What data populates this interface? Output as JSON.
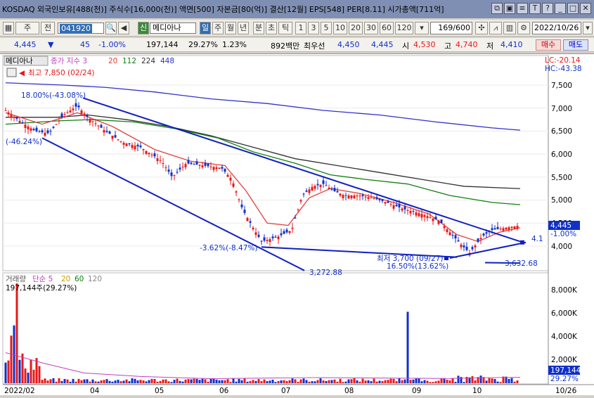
{
  "title_text": "KOSDAQ 외국인보유[488(천)] 주식수[16,000(천)] 액면[500] 자본금[80(억)] 결산[12월] EPS[548] PER[8.11] 시가총액[711억]",
  "toolbar": {
    "type_select": "주",
    "prev_label": "전",
    "code": "041920",
    "credit_badge": "신",
    "stock_name": "메디아나",
    "period_tabs": [
      "일",
      "주",
      "월",
      "년",
      "분",
      "초",
      "틱"
    ],
    "minute_options": [
      "1",
      "3",
      "5",
      "10",
      "20",
      "30",
      "60",
      "120"
    ],
    "page_counter": "169/600",
    "date": "2022/10/26"
  },
  "quote": {
    "price": "4,445",
    "change": "45",
    "change_pct": "-1.00%",
    "volume": "197,144",
    "turnover_pct": "29.27%",
    "rate": "1.23%",
    "amount": "892백만",
    "priority": "최우선",
    "bid": "4,450",
    "ask": "4,445",
    "open_label": "시",
    "open": "4,530",
    "high_label": "고",
    "high": "4,740",
    "low_label": "저",
    "low": "4,410",
    "buy_label": "매수",
    "sell_label": "매도"
  },
  "price_legend": {
    "stock": "메디아나",
    "ma_label": "종가 지수 3",
    "ma": [
      "20",
      "112",
      "224",
      "448"
    ],
    "lc": "LC:-20.14",
    "hc": "HC:-43.38",
    "high_note": "최고 7,850 (02/24)",
    "ann_top": "18.00%(-43.08%)",
    "ann_left": "(-46.24%)",
    "ann_low": "-3.62%(-8.47%)",
    "ann_min": "최저 3,700 (09/27)",
    "ann_min2": "16.50%(13.62%)",
    "ann_line": "3,632.68",
    "ann_bottom": "3,272.88",
    "ann_right": "4.1",
    "cur_price_tag": "4,445",
    "cur_pct_tag": "-1.00%",
    "price_ticks": [
      "7,500",
      "7,000",
      "6,500",
      "6,000",
      "5,500",
      "5,000",
      "4,500",
      "4,000"
    ]
  },
  "volume_legend": {
    "label": "거래량",
    "ma_label": "단순 5",
    "ma": [
      "20",
      "60",
      "120"
    ],
    "vol_note": "197,144주(29.27%)",
    "vol_ticks": [
      "8,000K",
      "6,000K",
      "4,000K",
      "2,000K"
    ],
    "cur_vol_tag": "197,144",
    "cur_vol_pct": "29.27%"
  },
  "x_ticks": [
    "2022/02",
    "04",
    "05",
    "06",
    "07",
    "08",
    "09",
    "10",
    "10/26"
  ],
  "colors": {
    "up": "#e81818",
    "down": "#1030c8",
    "ma20": "#e04040",
    "ma112": "#108010",
    "ma224": "#303030",
    "ma448": "#3030d0",
    "trend": "#1020c0"
  }
}
